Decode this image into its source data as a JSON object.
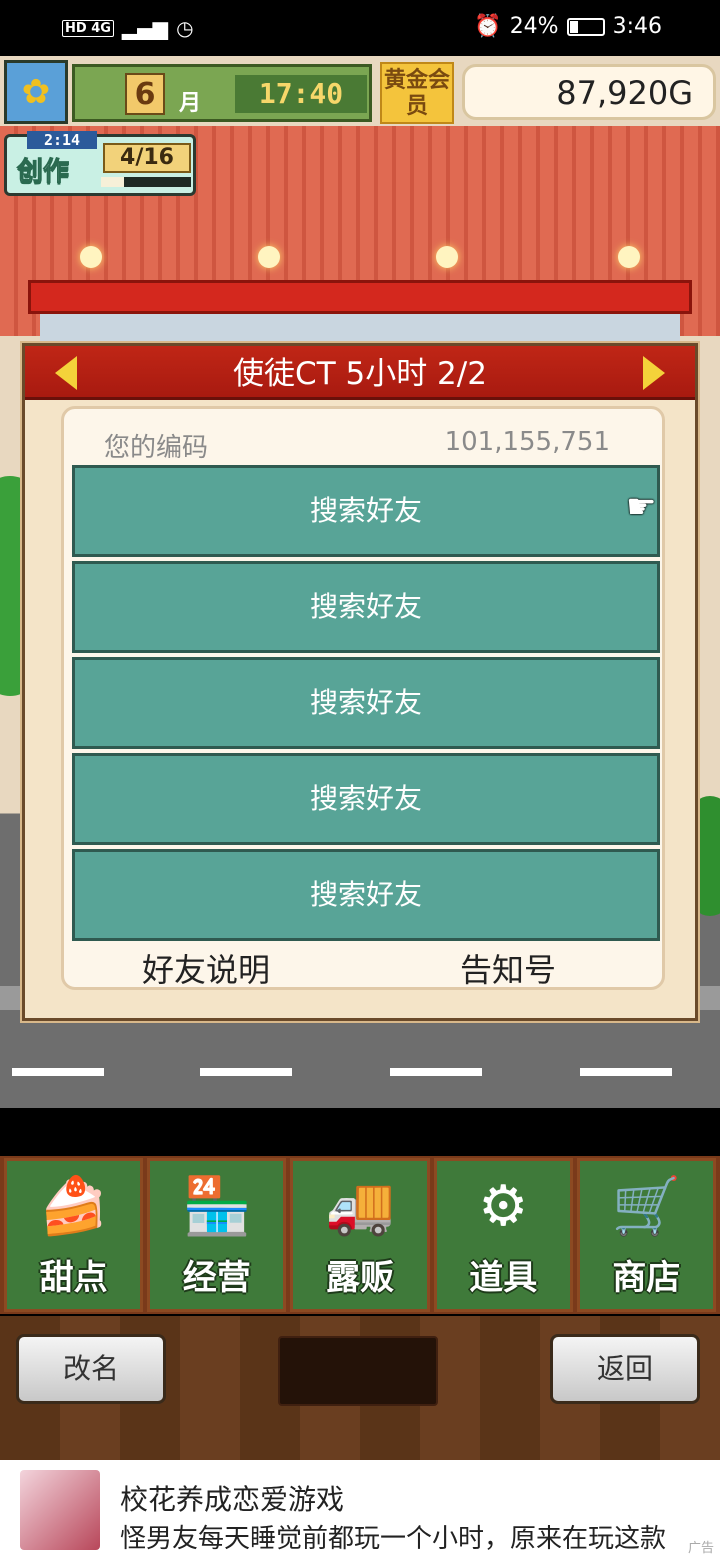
{
  "status_bar": {
    "network": "HD 4G",
    "battery": "24%",
    "battery_level": 0.24,
    "time": "3:46"
  },
  "hud": {
    "month": "6",
    "month_unit": "月",
    "clock": "17:40",
    "gold_member": "黄金会员",
    "money": "87,920G",
    "create_timer": "2:14",
    "create_label": "创作",
    "create_count": "4/16",
    "create_progress": 0.25
  },
  "dialog": {
    "title": "使徒CT  5小时 2/2",
    "code_label": "您的编码",
    "code_value": "101,155,751",
    "friend_buttons": [
      "搜索好友",
      "搜索好友",
      "搜索好友",
      "搜索好友",
      "搜索好友"
    ],
    "link_explain": "好友说明",
    "link_notice": "告知号"
  },
  "menu": {
    "items": [
      {
        "label": "甜点",
        "icon": "cake-icon"
      },
      {
        "label": "经营",
        "icon": "shop-icon"
      },
      {
        "label": "露贩",
        "icon": "food-truck-icon"
      },
      {
        "label": "道具",
        "icon": "items-bag-icon"
      },
      {
        "label": "商店",
        "icon": "shopping-cart-icon"
      }
    ]
  },
  "bottom": {
    "rename": "改名",
    "back": "返回"
  },
  "ad": {
    "title": "校花养成恋爱游戏",
    "description": "怪男友每天睡觉前都玩一个小时，原来在玩这款",
    "tag": "广告"
  }
}
